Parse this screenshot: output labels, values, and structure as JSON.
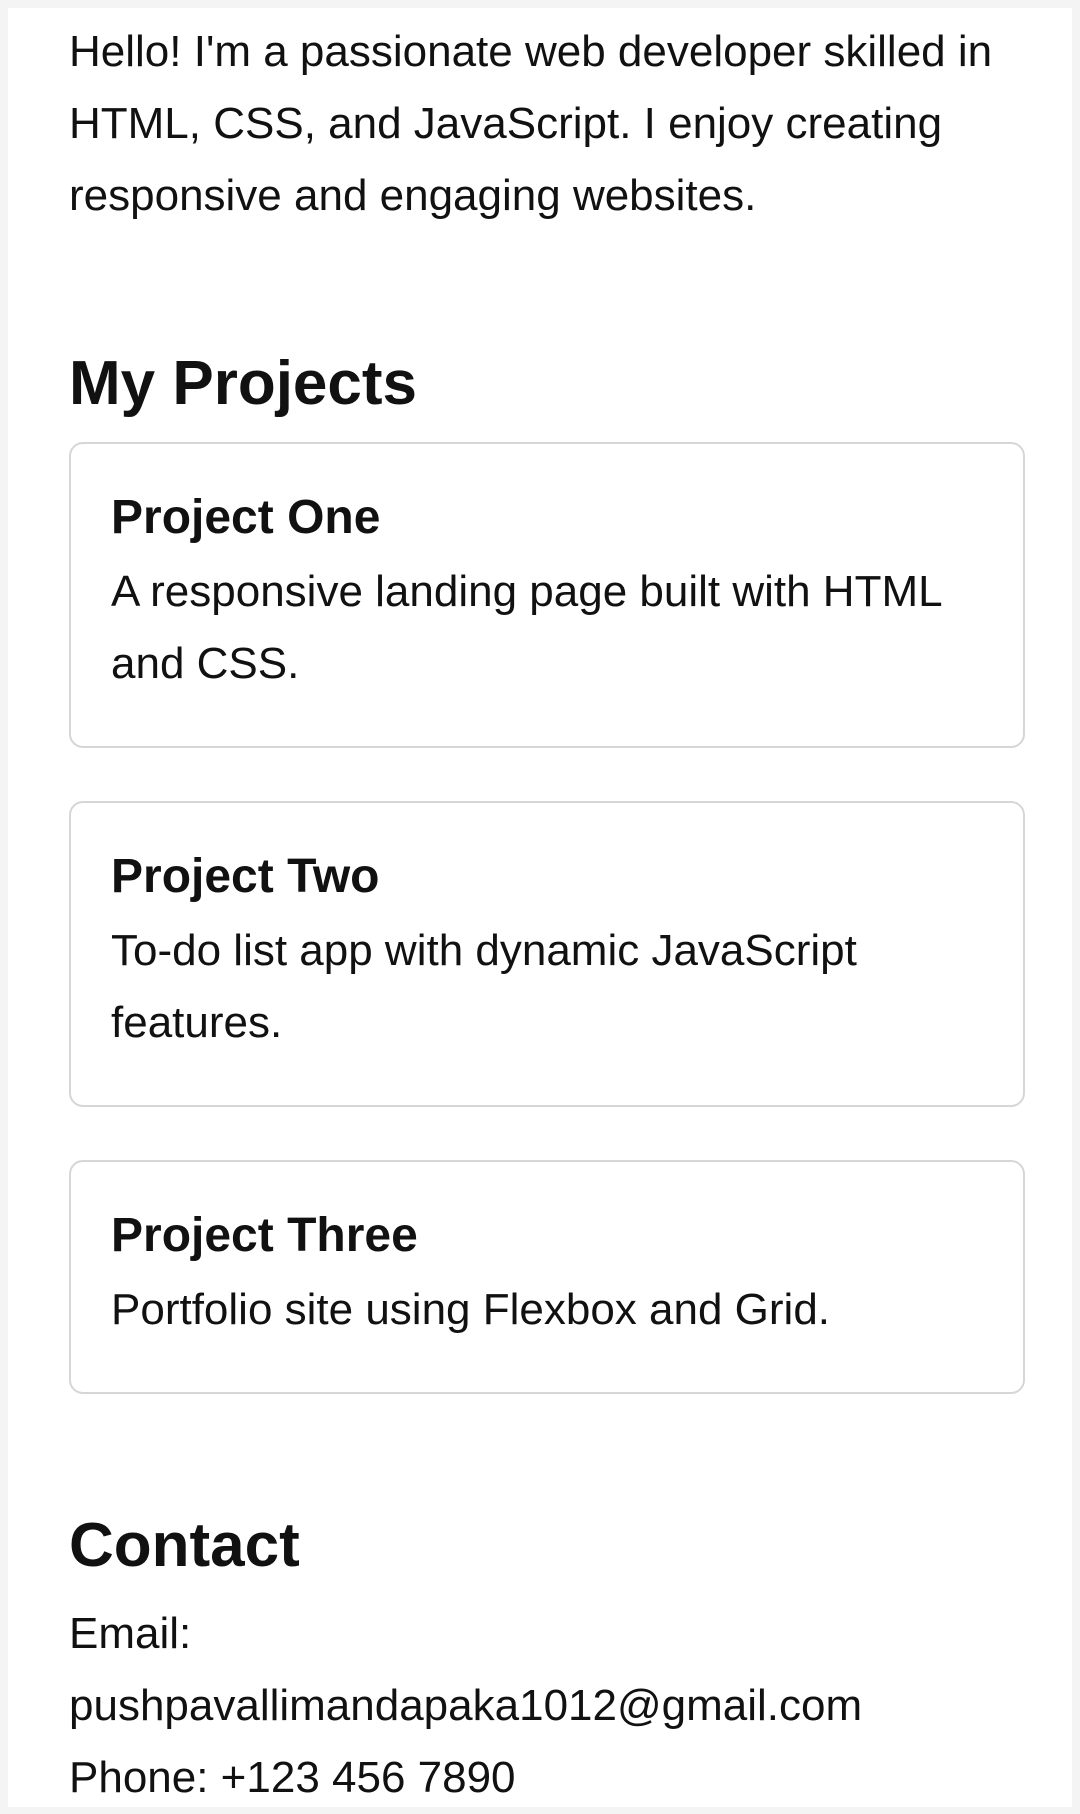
{
  "about": {
    "text": "Hello! I'm a passionate web developer skilled in HTML, CSS, and JavaScript. I enjoy creating responsive and engaging websites."
  },
  "projects": {
    "heading": "My Projects",
    "items": [
      {
        "title": "Project One",
        "description": "A responsive landing page built with HTML and CSS."
      },
      {
        "title": "Project Two",
        "description": "To-do list app with dynamic JavaScript features."
      },
      {
        "title": "Project Three",
        "description": "Portfolio site using Flexbox and Grid."
      }
    ]
  },
  "contact": {
    "heading": "Contact",
    "email_label": "Email:",
    "email": "pushpavallimandapaka1012@gmail.com",
    "phone": "Phone: +123 456 7890"
  }
}
